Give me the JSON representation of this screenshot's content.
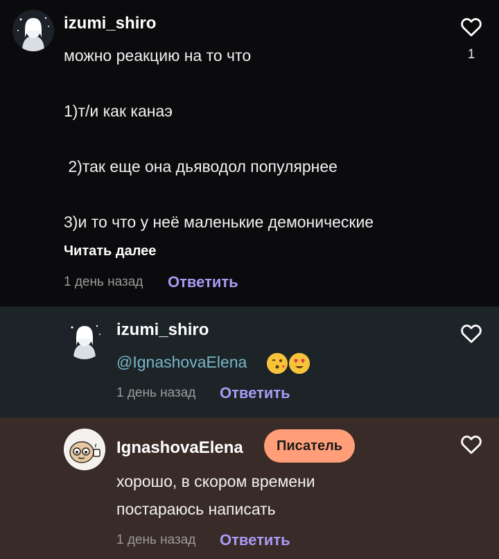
{
  "comments": [
    {
      "username": "izumi_shiro",
      "text_lines": [
        "можно реакцию на то что",
        "",
        "1)т/и как канаэ",
        "",
        " 2)так еще она дьяводол популярнее",
        "",
        "3)и то что у неё маленькие демонические"
      ],
      "read_more": "Читать далее",
      "time": "1 день назад",
      "reply_label": "Ответить",
      "like_count": "1"
    },
    {
      "username": "izumi_shiro",
      "mention": "@IgnashovaElena",
      "emojis": [
        "kissing-heart-emoji",
        "heart-eyes-emoji"
      ],
      "time": "1 день назад",
      "reply_label": "Ответить"
    },
    {
      "username": "IgnashovaElena",
      "badge": "Писатель",
      "text_lines": [
        "хорошо, в скором времени",
        "постараюсь написать"
      ],
      "time": "1 день назад",
      "reply_label": "Ответить"
    }
  ],
  "colors": {
    "background": "#0b0b0e",
    "reply_bg": "#1c2427",
    "author_bg": "#392b28",
    "reply_link": "#a79bf2",
    "mention": "#78b6c8",
    "badge": "#ff9e78"
  },
  "icons": [
    "heart-outline-icon",
    "avatar-anime-girl",
    "avatar-cartoon-face"
  ]
}
